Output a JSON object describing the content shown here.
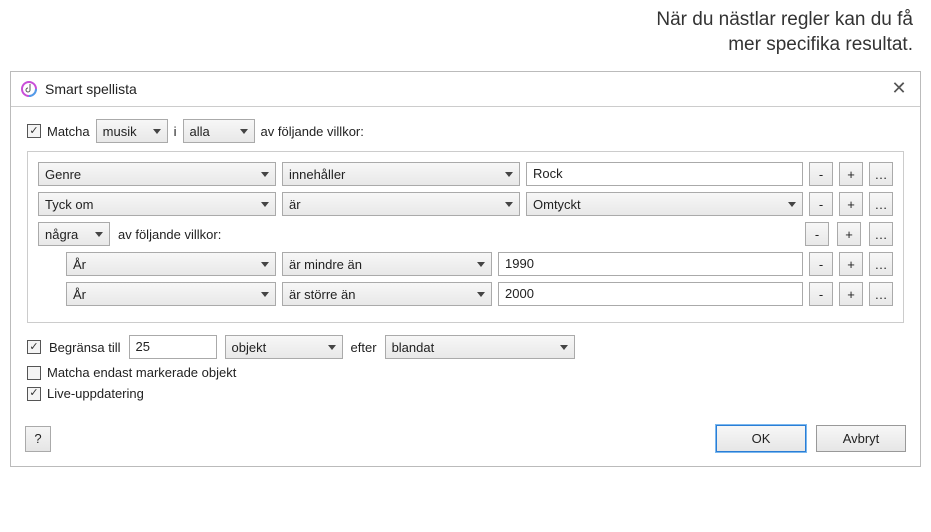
{
  "annotation": {
    "line1": "När du nästlar regler kan du få",
    "line2": "mer specifika resultat."
  },
  "dialog": {
    "title": "Smart spellista"
  },
  "match": {
    "label": "Matcha",
    "media": "musik",
    "in_word": "i",
    "quantifier": "alla",
    "suffix": "av följande villkor:"
  },
  "rules": [
    {
      "field": "Genre",
      "op": "innehåller",
      "value": "Rock",
      "value_is_select": false
    },
    {
      "field": "Tyck om",
      "op": "är",
      "value": "Omtyckt",
      "value_is_select": true
    }
  ],
  "nested_group": {
    "quantifier": "några",
    "suffix": "av följande villkor:",
    "rules": [
      {
        "field": "År",
        "op": "är mindre än",
        "value": "1990"
      },
      {
        "field": "År",
        "op": "är större än",
        "value": "2000"
      }
    ]
  },
  "rule_buttons": {
    "minus": "-",
    "plus": "+",
    "more": "…"
  },
  "limit": {
    "label": "Begränsa till",
    "value": "25",
    "unit": "objekt",
    "after_label": "efter",
    "after_value": "blandat"
  },
  "checked_only": "Matcha endast markerade objekt",
  "live_update": "Live-uppdatering",
  "buttons": {
    "help": "?",
    "ok": "OK",
    "cancel": "Avbryt"
  }
}
